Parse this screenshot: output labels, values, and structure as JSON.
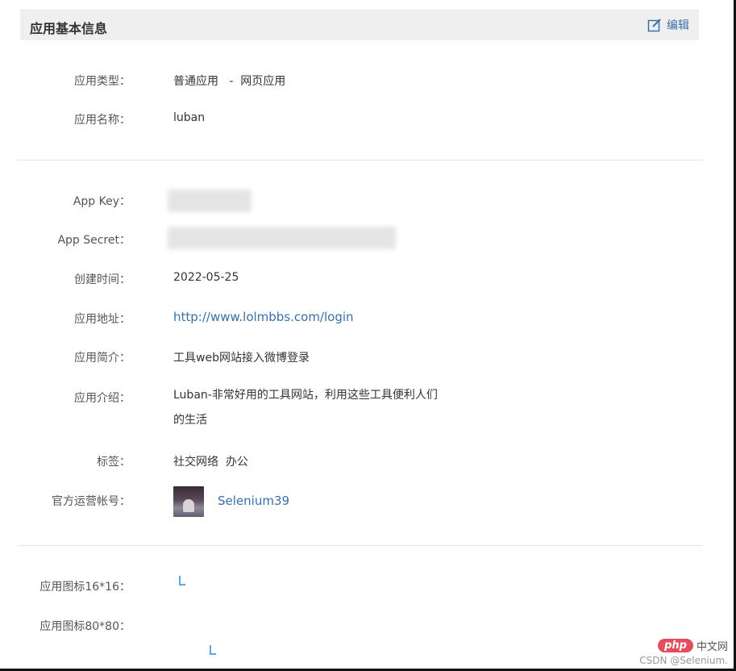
{
  "header": {
    "title": "应用基本信息",
    "edit_label": "编辑"
  },
  "basic": [
    {
      "label": "应用类型：",
      "value": "普通应用   -  网页应用"
    },
    {
      "label": "应用名称：",
      "value": "luban"
    }
  ],
  "keys": {
    "app_key_label": "App Key：",
    "app_secret_label": "App Secret："
  },
  "details": {
    "created_label": "创建时间：",
    "created_value": "2022-05-25",
    "url_label": "应用地址：",
    "url_value": "http://www.lolmbbs.com/login",
    "summary_label": "应用简介：",
    "summary_value": "工具web网站接入微博登录",
    "intro_label": "应用介绍：",
    "intro_value": "Luban-非常好用的工具网站，利用这些工具便利人们的生活",
    "tags_label": "标签：",
    "tags_value": "社交网络  办公",
    "account_label": "官方运营帐号：",
    "account_name": "Selenium39"
  },
  "icons": {
    "icon16_label": "应用图标16*16：",
    "icon80_label": "应用图标80*80："
  },
  "watermark": {
    "logo": "php",
    "cn": "中文网",
    "csdn": "CSDN @Selenium."
  }
}
